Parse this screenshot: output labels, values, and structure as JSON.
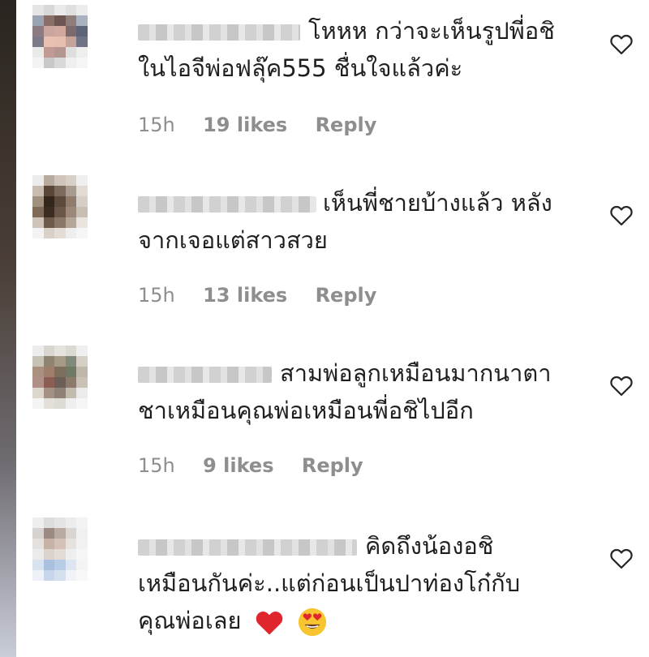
{
  "comments": [
    {
      "line1": "โหหห กว่าจะเห็นรูปพี่อชิ",
      "line2": "ในไอจีพ่อฟลุ๊ค555 ชื่นใจแล้วค่ะ",
      "time": "15h",
      "likes": "19 likes",
      "reply": "Reply"
    },
    {
      "line1": "เห็นพี่ชายบ้างแล้ว หลัง",
      "line2": "จากเจอแต่สาวสวย",
      "time": "15h",
      "likes": "13 likes",
      "reply": "Reply"
    },
    {
      "line1": "สามพ่อลูกเหมือนมากนาตา",
      "line2": "ชาเหมือนคุณพ่อเหมือนพี่อชิไปอีก",
      "time": "15h",
      "likes": "9 likes",
      "reply": "Reply"
    },
    {
      "line1": "คิดถึงน้องอชิ",
      "line2": "เหมือนกันค่ะ..แต่ก่อนเป็นปาท่องโก๋กับ",
      "line3": "คุณพ่อเลย"
    }
  ],
  "icons": {
    "like": "heart-outline-icon",
    "red_heart": "red-heart-emoji-icon",
    "heart_eyes": "heart-eyes-emoji-icon"
  },
  "colors": {
    "meta_gray": "#8e8e8e",
    "heart_red": "#e0262d",
    "emoji_yellow": "#f8c531"
  }
}
